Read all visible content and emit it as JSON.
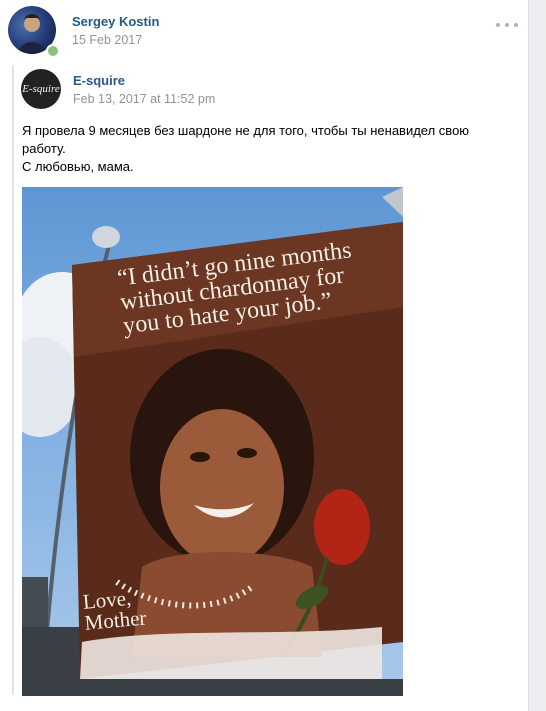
{
  "post": {
    "author": "Sergey Kostin",
    "date": "15 Feb 2017",
    "more_icon": "more-dots-icon"
  },
  "repost": {
    "source_name": "E-squire",
    "source_logo_text": "E-squire",
    "date": "Feb 13, 2017 at 11:52 pm",
    "text_line1": "Я провела 9 месяцев без шардоне не для того, чтобы ты ненавидел свою работу.",
    "text_line2": "С любовью, мама."
  },
  "billboard": {
    "quote": "“I didn’t go nine months without chardonnay for you to hate your job.”",
    "signoff_line1": "Love,",
    "signoff_line2": "Mother"
  },
  "colors": {
    "link": "#2a5885",
    "muted": "#939393",
    "online": "#8ac176"
  }
}
